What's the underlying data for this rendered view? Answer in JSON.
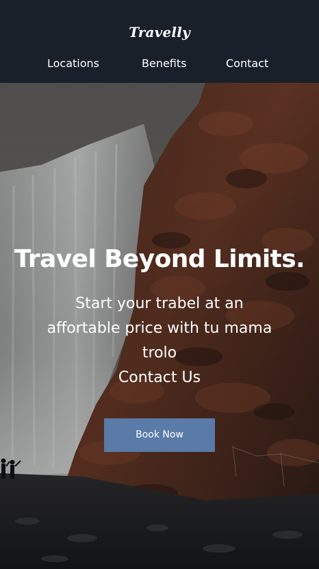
{
  "header": {
    "brand": "Travelly",
    "nav": [
      {
        "label": "Locations"
      },
      {
        "label": "Benefits"
      },
      {
        "label": "Contact"
      }
    ]
  },
  "hero": {
    "title": "Travel Beyond Limits.",
    "subtitle_lines": [
      "Start your trabel at an",
      "affortable price with tu mama",
      "trolo",
      "Contact Us"
    ],
    "cta_label": "Book Now"
  },
  "colors": {
    "header_bg": "#1a202a",
    "button_bg": "#5a7aa8",
    "text": "#ffffff"
  }
}
